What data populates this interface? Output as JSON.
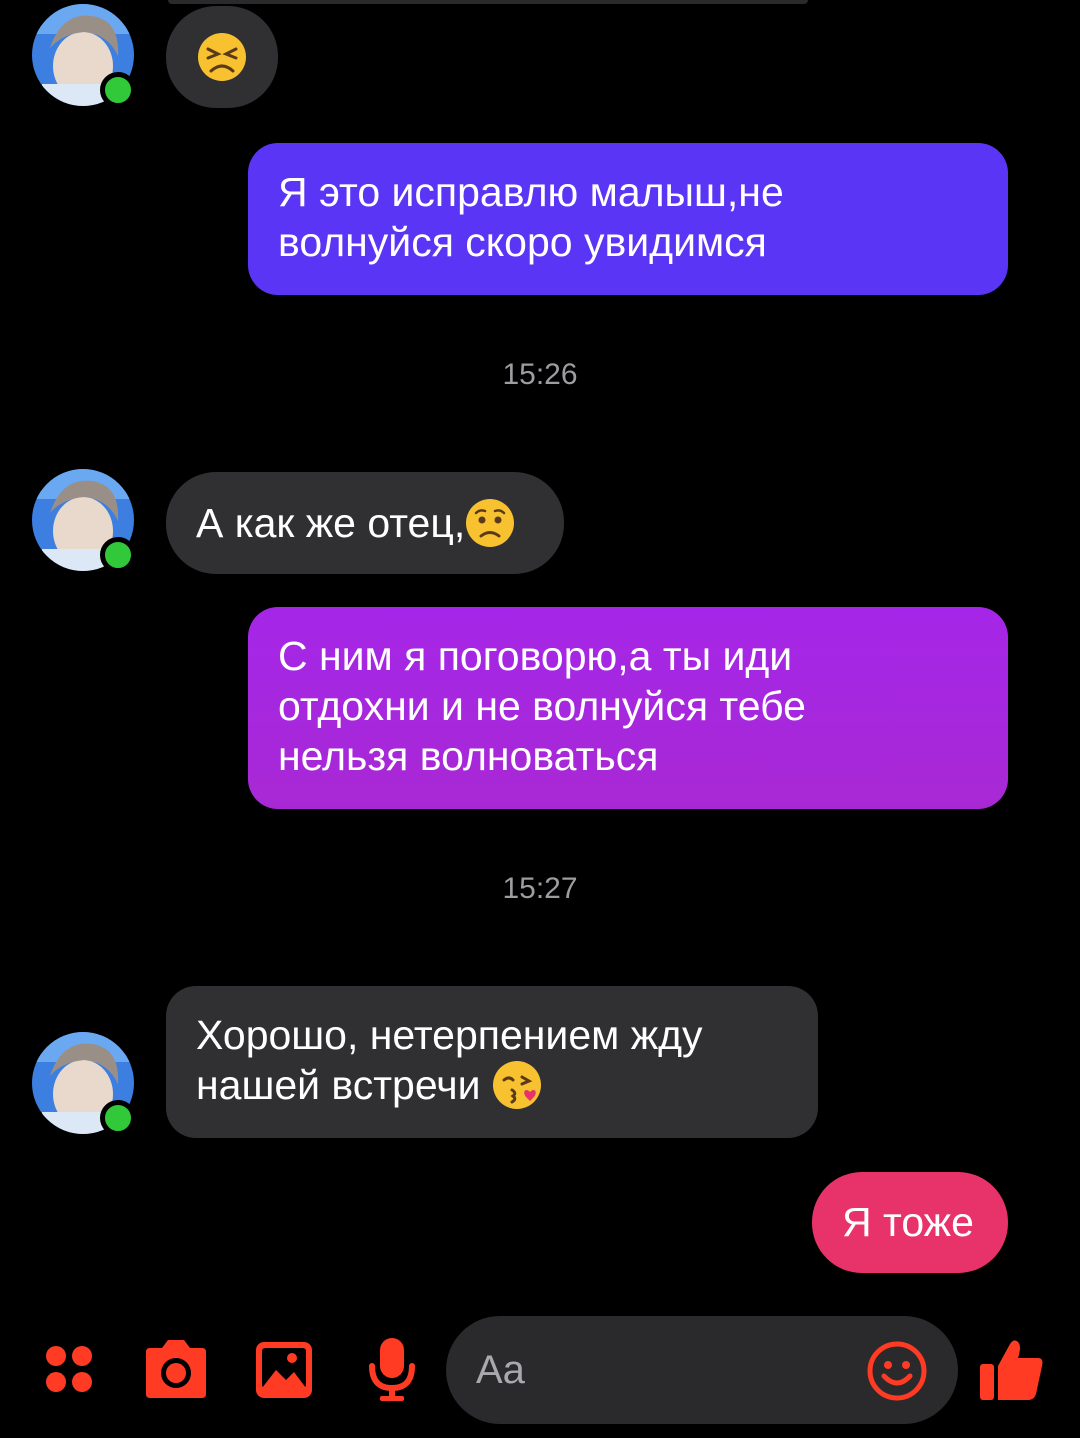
{
  "chat": {
    "messages": [
      {
        "from": "contact",
        "emoji": "tired-face-emoji"
      },
      {
        "from": "me",
        "lines": [
          "Я это исправлю малыш,не",
          "волнуйся скоро увидимся"
        ]
      },
      {
        "type": "timestamp",
        "text": "15:26"
      },
      {
        "from": "contact",
        "text": "А как же отец,",
        "emoji": "worried-face-emoji"
      },
      {
        "from": "me",
        "lines": [
          "С ним я поговорю,а ты иди",
          "отдохни и не волнуйся тебе",
          "нельзя волноваться"
        ]
      },
      {
        "type": "timestamp",
        "text": "15:27"
      },
      {
        "from": "contact",
        "lines": [
          "Хорошо, нетерпением жду",
          "нашей встречи "
        ],
        "emoji": "face-blowing-kiss-emoji"
      },
      {
        "from": "me",
        "text": "Я тоже"
      }
    ]
  },
  "composer": {
    "placeholder": "Aa",
    "icons": [
      "menu-dots-icon",
      "camera-icon",
      "gallery-icon",
      "microphone-icon",
      "emoji-smile-icon",
      "thumbs-up-icon"
    ]
  },
  "colors": {
    "incoming_bubble": "#303033",
    "outgoing_blue": "#5b35f6",
    "outgoing_purple": "#a726e0",
    "outgoing_pink": "#e8336a",
    "accent": "#ff3b24",
    "online": "#31c93a",
    "timestamp": "#9c9ca1"
  }
}
